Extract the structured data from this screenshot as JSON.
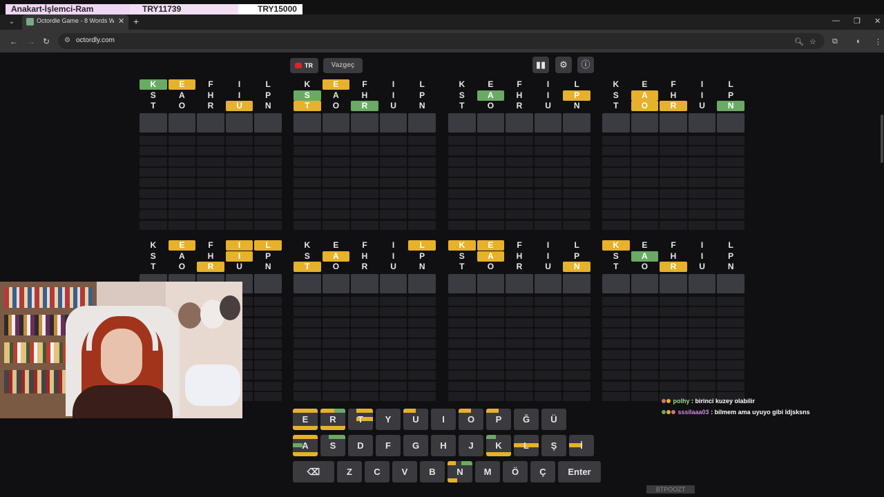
{
  "overlay": {
    "part_name": "Anakart-İşlemci-Ram",
    "price_1": "TRY11739",
    "price_2": "TRY15000"
  },
  "browser": {
    "tab_title": "Octordle Game - 8 Words Word...",
    "url": "octordly.com"
  },
  "toolbar": {
    "language": "TR",
    "give_up": "Vazgeç",
    "stats_icon": "bar-chart-icon",
    "settings_icon": "gear-icon",
    "info_icon": "info-icon"
  },
  "colors": {
    "green": "#6aaa64",
    "yellow": "#e6b12b",
    "key": "#3a3a3f",
    "background": "#101012"
  },
  "boards": [
    {
      "guesses": [
        {
          "letters": [
            "K",
            "E",
            "F",
            "I",
            "L"
          ],
          "states": [
            "g",
            "y",
            "",
            "",
            ""
          ]
        },
        {
          "letters": [
            "S",
            "A",
            "H",
            "I",
            "P"
          ],
          "states": [
            "",
            "",
            "",
            "",
            ""
          ]
        },
        {
          "letters": [
            "T",
            "O",
            "R",
            "U",
            "N"
          ],
          "states": [
            "",
            "",
            "",
            "y",
            ""
          ]
        }
      ]
    },
    {
      "guesses": [
        {
          "letters": [
            "K",
            "E",
            "F",
            "I",
            "L"
          ],
          "states": [
            "",
            "y",
            "",
            "",
            ""
          ]
        },
        {
          "letters": [
            "S",
            "A",
            "H",
            "I",
            "P"
          ],
          "states": [
            "g",
            "",
            "",
            "",
            ""
          ]
        },
        {
          "letters": [
            "T",
            "O",
            "R",
            "U",
            "N"
          ],
          "states": [
            "y",
            "",
            "g",
            "",
            ""
          ]
        }
      ]
    },
    {
      "guesses": [
        {
          "letters": [
            "K",
            "E",
            "F",
            "I",
            "L"
          ],
          "states": [
            "",
            "",
            "",
            "",
            ""
          ]
        },
        {
          "letters": [
            "S",
            "A",
            "H",
            "I",
            "P"
          ],
          "states": [
            "",
            "g",
            "",
            "",
            "y"
          ]
        },
        {
          "letters": [
            "T",
            "O",
            "R",
            "U",
            "N"
          ],
          "states": [
            "",
            "",
            "",
            "",
            ""
          ]
        }
      ]
    },
    {
      "guesses": [
        {
          "letters": [
            "K",
            "E",
            "F",
            "I",
            "L"
          ],
          "states": [
            "",
            "",
            "",
            "",
            ""
          ]
        },
        {
          "letters": [
            "S",
            "A",
            "H",
            "I",
            "P"
          ],
          "states": [
            "",
            "y",
            "",
            "",
            ""
          ]
        },
        {
          "letters": [
            "T",
            "O",
            "R",
            "U",
            "N"
          ],
          "states": [
            "",
            "y",
            "y",
            "",
            "g"
          ]
        }
      ]
    },
    {
      "guesses": [
        {
          "letters": [
            "K",
            "E",
            "F",
            "I",
            "L"
          ],
          "states": [
            "",
            "y",
            "",
            "y",
            "y"
          ]
        },
        {
          "letters": [
            "S",
            "A",
            "H",
            "I",
            "P"
          ],
          "states": [
            "",
            "",
            "",
            "y",
            ""
          ]
        },
        {
          "letters": [
            "T",
            "O",
            "R",
            "U",
            "N"
          ],
          "states": [
            "",
            "",
            "y",
            "",
            ""
          ]
        }
      ]
    },
    {
      "guesses": [
        {
          "letters": [
            "K",
            "E",
            "F",
            "I",
            "L"
          ],
          "states": [
            "",
            "",
            "",
            "",
            "y"
          ]
        },
        {
          "letters": [
            "S",
            "A",
            "H",
            "I",
            "P"
          ],
          "states": [
            "",
            "y",
            "",
            "",
            ""
          ]
        },
        {
          "letters": [
            "T",
            "O",
            "R",
            "U",
            "N"
          ],
          "states": [
            "y",
            "",
            "",
            "",
            ""
          ]
        }
      ]
    },
    {
      "guesses": [
        {
          "letters": [
            "K",
            "E",
            "F",
            "I",
            "L"
          ],
          "states": [
            "y",
            "y",
            "",
            "",
            ""
          ]
        },
        {
          "letters": [
            "S",
            "A",
            "H",
            "I",
            "P"
          ],
          "states": [
            "",
            "y",
            "",
            "",
            ""
          ]
        },
        {
          "letters": [
            "T",
            "O",
            "R",
            "U",
            "N"
          ],
          "states": [
            "",
            "",
            "",
            "",
            "y"
          ]
        }
      ]
    },
    {
      "guesses": [
        {
          "letters": [
            "K",
            "E",
            "F",
            "I",
            "L"
          ],
          "states": [
            "y",
            "",
            "",
            "",
            ""
          ]
        },
        {
          "letters": [
            "S",
            "A",
            "H",
            "I",
            "P"
          ],
          "states": [
            "",
            "g",
            "",
            "",
            ""
          ]
        },
        {
          "letters": [
            "T",
            "O",
            "R",
            "U",
            "N"
          ],
          "states": [
            "",
            "",
            "y",
            "",
            ""
          ]
        }
      ]
    }
  ],
  "keyboard": {
    "row1": [
      "E",
      "R",
      "T",
      "Y",
      "U",
      "I",
      "O",
      "P",
      "Ğ",
      "Ü"
    ],
    "row2": [
      "A",
      "S",
      "D",
      "F",
      "G",
      "H",
      "J",
      "K",
      "L",
      "Ş",
      "İ"
    ],
    "row3": [
      "Z",
      "C",
      "V",
      "B",
      "N",
      "M",
      "Ö",
      "Ç"
    ],
    "enter": "Enter",
    "backspace_icon": "backspace-icon"
  },
  "chat": [
    {
      "user": "polhy",
      "message": ": birinci kuzey olabilir"
    },
    {
      "user": "sssilaaa03",
      "message": ": bilmem ama uyuyo gibi ldjsksns"
    }
  ],
  "bottom_tag": "BTPOOZT"
}
